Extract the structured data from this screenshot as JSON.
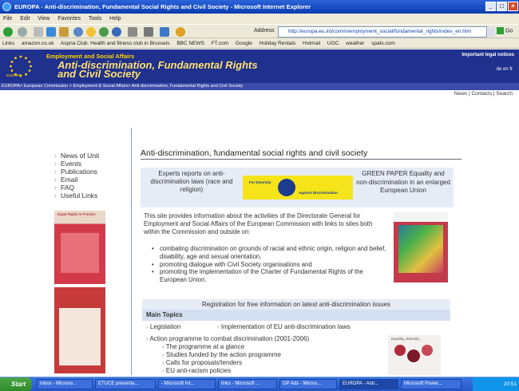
{
  "window": {
    "title": "EUROPA - Anti-discrimination, Fundamental Social Rights and Civil Society - Microsoft Internet Explorer",
    "menu": [
      "File",
      "Edit",
      "View",
      "Favorites",
      "Tools",
      "Help"
    ],
    "address_label": "Address",
    "address": "http://europa.eu.int/comm/employment_social/fundamental_rights/index_en.htm",
    "go_label": "Go",
    "links": [
      "Links",
      "amazon.co.uk",
      "Aspria Club. Health and fitness club in Brussels",
      "BBC NEWS",
      "FT.com",
      "Google",
      "Holiday Rentals",
      "Hotmail",
      "UGC",
      "weather",
      "spats.com"
    ]
  },
  "banner": {
    "subtitle": "Employment and Social Affairs",
    "title_line1": "Anti-discrimination, Fundamental Rights",
    "title_line2": "and Civil Society",
    "legal": "Important legal notices",
    "lang": "de en fr",
    "europa": "EUROPE"
  },
  "breadcrumb": "EUROPA> European Commission > Employment & Social Affairs> Anti-discrimination, Fundamental Rights and Civil Society",
  "util_links": "News | Contacts | Search",
  "left_nav": [
    "News of Unit",
    "Events",
    "Publications",
    "Email",
    "FAQ",
    "Useful Links"
  ],
  "content": {
    "title": "Anti-discrimination, fundamental social rights and civil society",
    "pub_left": "Experts reports on anti-discrimination laws (race and religion)",
    "diversity_s1": "For Diversity",
    "diversity_s2": "Against Discrimination",
    "pub_right": "GREEN PAPER Equality and non-discrimination in an enlarged European Union",
    "intro": "This site provides information about the activities of the Directorate General for Employment and Social Affairs of the European Commission with links to sites both within the Commission and outside on:",
    "bullets": [
      "combating discrimination on grounds of racial and ethnic origin, religion and belief, disability, age and sexual orientation,",
      "promoting dialogue with Civil Society organisations and",
      "promoting the implementation of the Charter of Fundamental Rights of the European Union."
    ],
    "registration": "Registration for free information on latest anti-discrimination issues",
    "main_topics": "Main Topics",
    "topic_legislation": "Legislation",
    "topic_implementation": "Implementation of  EU anti-discrimination laws",
    "topic_action": "Action programme to combat discrimination (2001-2006)",
    "sub_topics": [
      "The programme at a glance",
      "Studies funded by the action programme",
      "Calls for proposals/tenders",
      "EU anti-racism policies"
    ],
    "cover1_title": "Equal Rights in Practice",
    "cover2_title": "Equality, diversity..."
  },
  "taskbar": {
    "start": "Start",
    "tasks": [
      "Inbox - Microso...",
      "ETUCE presenta...",
      "- Microsoft Int...",
      "links - Microsoft ...",
      "GP Ads - Micros...",
      "EUROPA - Anti...",
      "Microsoft Power..."
    ],
    "clock": "20:51"
  },
  "colors": {
    "banner": "#20308d",
    "accent": "#ffd200",
    "titlebar": "#0a3cb0"
  }
}
